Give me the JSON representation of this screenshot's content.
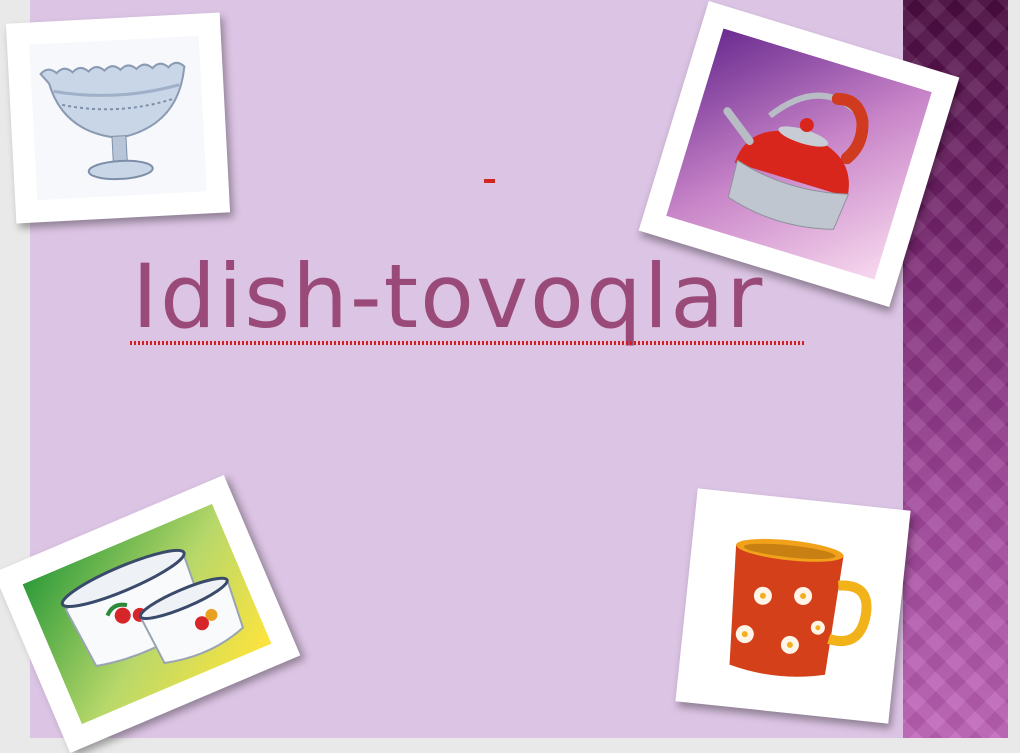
{
  "slide": {
    "title": "Idish-tovoqlar",
    "colors": {
      "background": "#dcc4e4",
      "title": "#9a4a78",
      "band_top": "#4a0c40",
      "band_bottom": "#bf63b8"
    }
  },
  "images": {
    "vase": "crystal-fruit-bowl",
    "kettle": "red-kettle",
    "pots": "enamel-pots",
    "mug": "red-flower-mug"
  }
}
